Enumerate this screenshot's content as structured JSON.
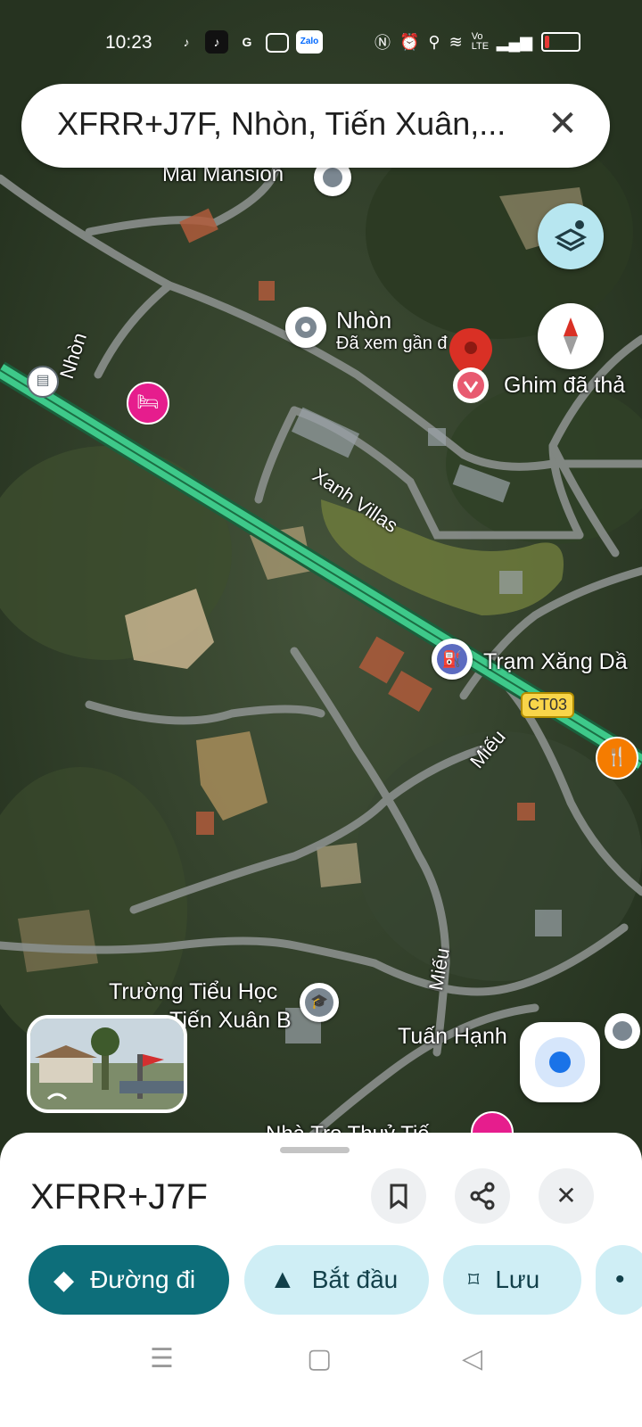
{
  "status_bar": {
    "time": "10:23",
    "app_icons": [
      "tiktok-icon",
      "tiktok-icon",
      "google-icon",
      "gallery-icon",
      "zalo-icon"
    ],
    "zalo_label": "Zalo",
    "network_label": "Vo LTE",
    "battery_level": 0.15,
    "battery_color": "#e53935"
  },
  "search": {
    "query": "XFRR+J7F, Nhòn, Tiến Xuân,..."
  },
  "map": {
    "labels": {
      "mai_mansion": "Mai Mansion",
      "nhon": "Nhòn",
      "nhon_sub": "Đã xem gần đ",
      "pin": "Ghim đã thả",
      "road_nhon": "Nhòn",
      "xanh_villas": "Xanh Villas",
      "gas_station": "Trạm Xăng Dầ",
      "road_badge": "CT03",
      "road_mieu_1": "Miếu",
      "road_mieu_2": "Miếu",
      "school_line1": "Trường Tiểu Học",
      "school_line2": "Tiến Xuân B",
      "tuan_hanh": "Tuấn Hạnh",
      "bottom_partial": "Nhà Trọ Thuỷ Tiế"
    },
    "colors": {
      "highway": "#3ec98a",
      "pin": "#d93025",
      "accent": "#0d6e7a"
    }
  },
  "place": {
    "title": "XFRR+J7F",
    "buttons": {
      "directions": "Đường đi",
      "start": "Bắt đầu",
      "save": "Lưu"
    }
  }
}
